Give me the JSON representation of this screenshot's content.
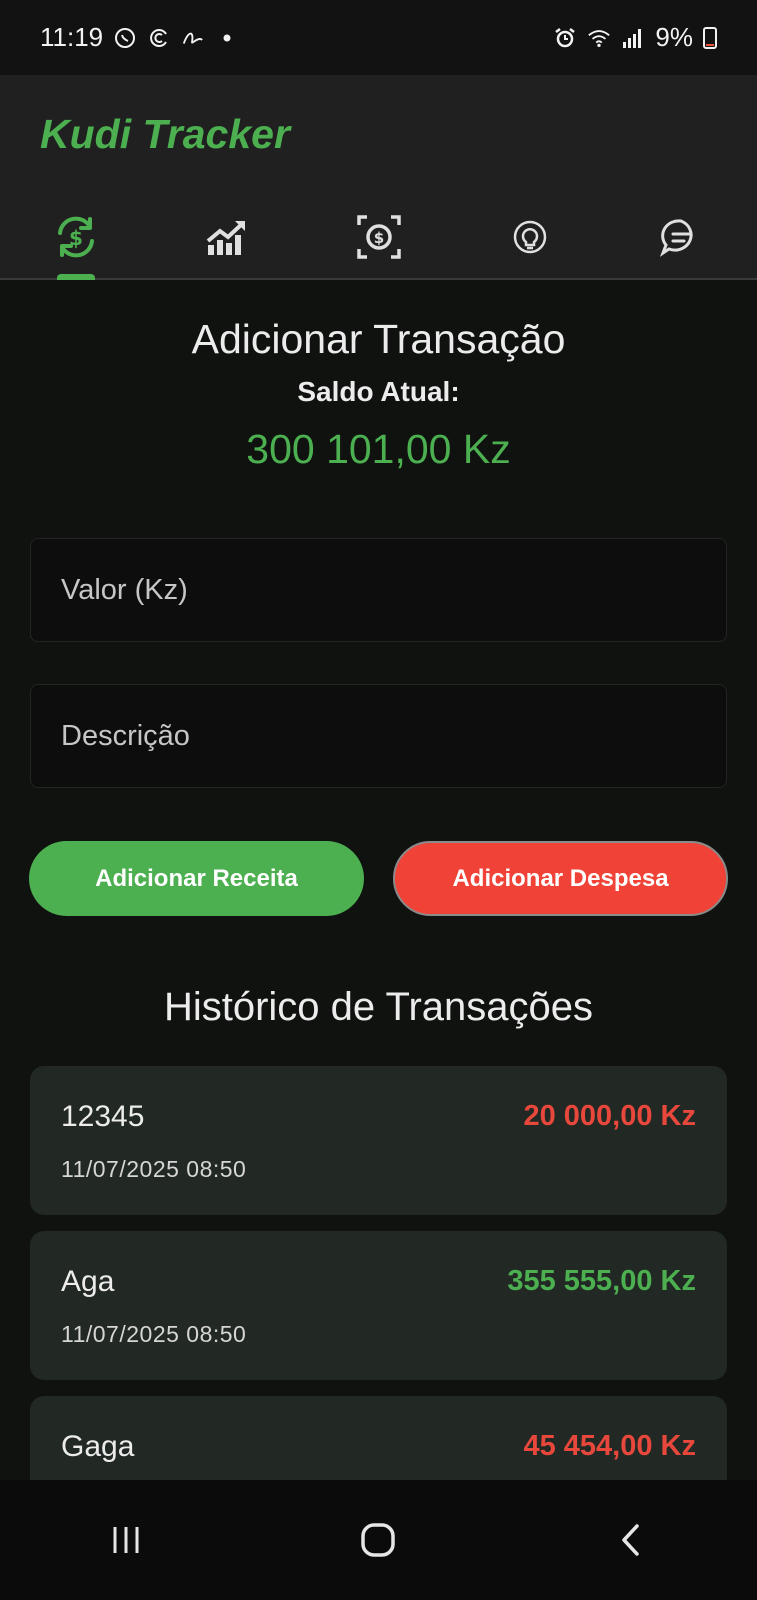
{
  "status_bar": {
    "time": "11:19",
    "battery": "9%",
    "battery_level": 0.09,
    "icons": [
      "whatsapp-icon",
      "sync-icon",
      "signature-icon",
      "dot-icon",
      "alarm-icon",
      "wifi-icon",
      "signal-icon",
      "battery-icon"
    ]
  },
  "app": {
    "title": "Kudi Tracker",
    "accent_color": "#4caf50",
    "expense_color": "#e8483c"
  },
  "tabs": [
    {
      "icon": "currency-exchange-icon",
      "selected": true
    },
    {
      "icon": "trending-chart-icon",
      "selected": false
    },
    {
      "icon": "money-scan-icon",
      "selected": false
    },
    {
      "icon": "lightbulb-icon",
      "selected": false
    },
    {
      "icon": "chat-icon",
      "selected": false
    }
  ],
  "add_section": {
    "title": "Adicionar Transação",
    "balance_label": "Saldo Atual:",
    "balance_value": "300 101,00 Kz",
    "amount_placeholder": "Valor (Kz)",
    "description_placeholder": "Descrição",
    "income_button": "Adicionar Receita",
    "expense_button": "Adicionar Despesa"
  },
  "history": {
    "title": "Histórico de Transações",
    "transactions": [
      {
        "description": "12345",
        "date": "11/07/2025 08:50",
        "amount": "20 000,00 Kz",
        "type": "expense"
      },
      {
        "description": "Aga",
        "date": "11/07/2025 08:50",
        "amount": "355 555,00 Kz",
        "type": "income"
      },
      {
        "description": "Gaga",
        "date": "",
        "amount": "45 454,00 Kz",
        "type": "expense"
      }
    ]
  },
  "navbar": {
    "icons": [
      "recent-apps-icon",
      "home-icon",
      "back-icon"
    ]
  }
}
